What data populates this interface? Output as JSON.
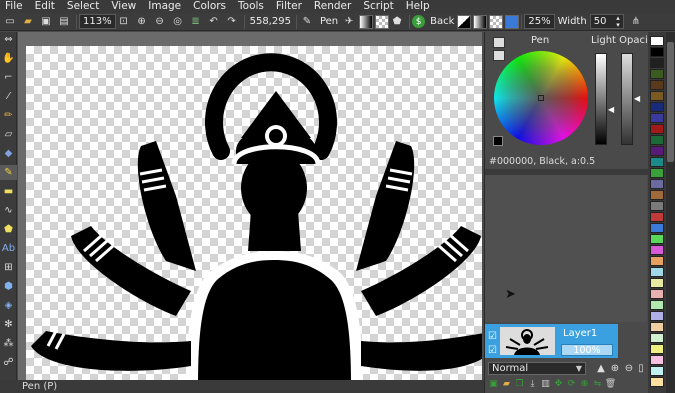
{
  "menu": [
    "File",
    "Edit",
    "Select",
    "View",
    "Image",
    "Colors",
    "Tools",
    "Filter",
    "Render",
    "Script",
    "Help"
  ],
  "toolbar": {
    "zoom_value": "113%",
    "coords": "558,295",
    "tool_label": "Pen",
    "back_label": "Back",
    "brush_zoom": "25%",
    "width_label": "Width",
    "width_value": "50"
  },
  "status": {
    "text": "Pen (P)"
  },
  "color_panel": {
    "tab_label": "Pen",
    "opacity_label": "Light Opacity",
    "readout": "#000000, Black, a:0.5"
  },
  "layers": {
    "name": "Layer1",
    "opacity": "100%",
    "blend_mode": "Normal"
  },
  "palette_colors": [
    "#ffffff",
    "#000000",
    "#202020",
    "#3a5c1e",
    "#5a3a1a",
    "#7a5a20",
    "#1a2a7a",
    "#3a3aa0",
    "#a01a1a",
    "#1a6a3a",
    "#5a1a7a",
    "#1a8a8a",
    "#3aa03a",
    "#6a6aa0",
    "#a06a3a",
    "#7a7a7a",
    "#c03a3a",
    "#3a7ad8",
    "#5ad85a",
    "#d85ad8",
    "#e8a060",
    "#a0d8e8",
    "#e8e8a0",
    "#e8b0b0",
    "#b0e8b0",
    "#b0b0e8",
    "#f0d0a0",
    "#d0f0d0",
    "#f0f080",
    "#f8c0e0",
    "#c0f0f0",
    "#ffe0a0"
  ]
}
